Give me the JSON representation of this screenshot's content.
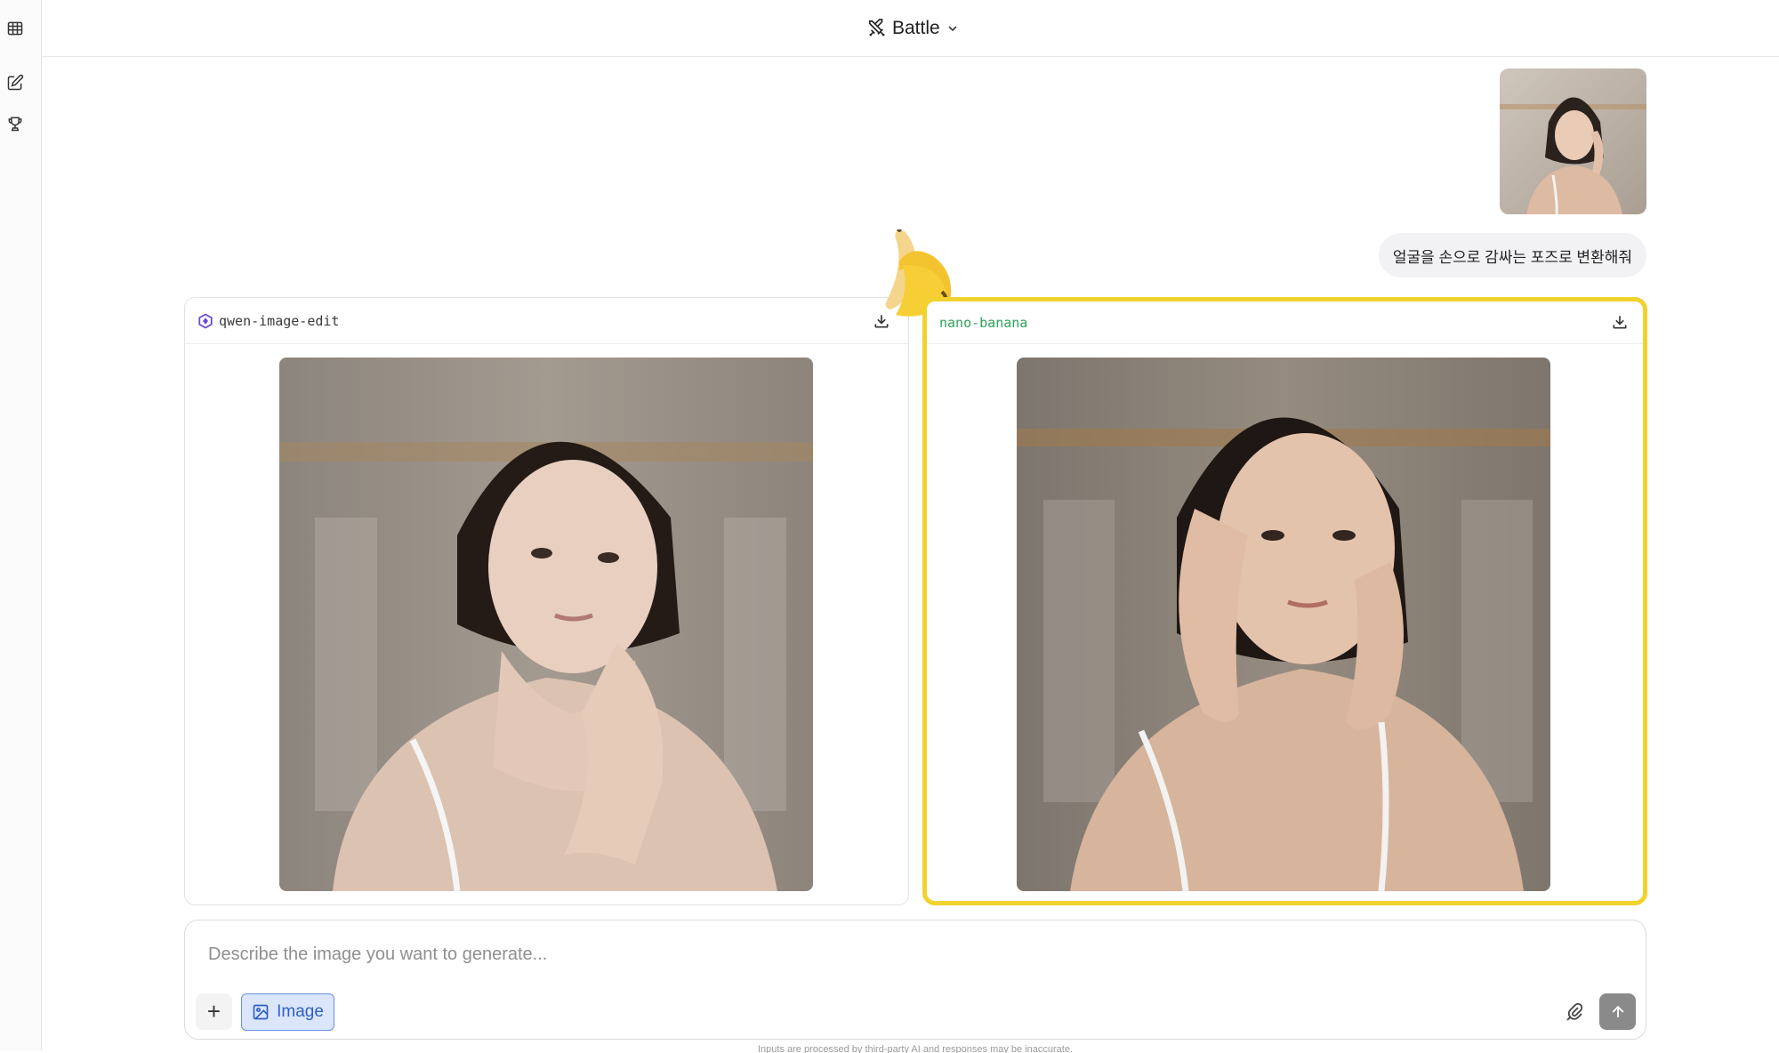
{
  "header": {
    "mode_label": "Battle"
  },
  "sidebar": {
    "items": [
      {
        "icon": "leaderboard-table-icon"
      },
      {
        "icon": "new-chat-icon"
      },
      {
        "icon": "trophy-icon"
      }
    ]
  },
  "conversation": {
    "user_prompt": "얼굴을 손으로 감싸는 포즈로 변환해줘",
    "responses": [
      {
        "model": "qwen-image-edit",
        "selected": false
      },
      {
        "model": "nano-banana",
        "selected": true,
        "badge": "banana-emoji"
      }
    ]
  },
  "composer": {
    "placeholder": "Describe the image you want to generate...",
    "image_chip_label": "Image",
    "add_label": "+"
  },
  "footer": {
    "disclaimer": "Inputs are processed by third-party AI and responses may be inaccurate."
  },
  "colors": {
    "selected_border": "#f2d22e",
    "nano_banana_name": "#2ea25a",
    "image_chip_bg": "#dbe6fb",
    "send_button": "#8a8a8a"
  }
}
